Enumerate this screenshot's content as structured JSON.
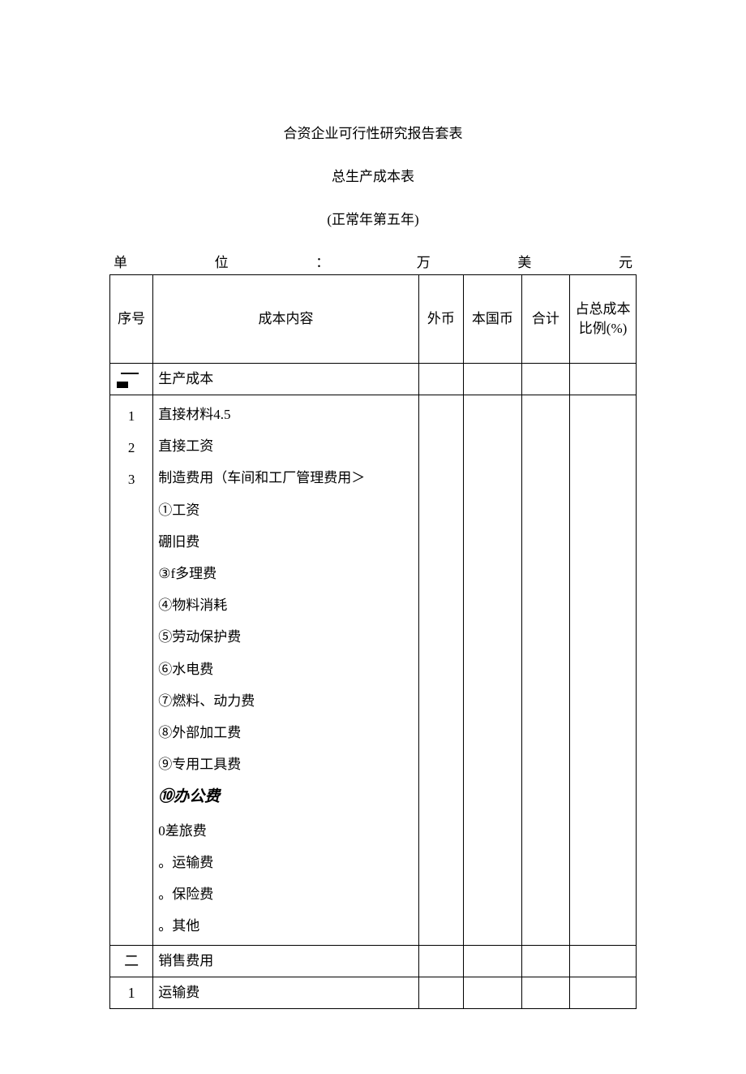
{
  "titles": {
    "main": "合资企业可行性研究报告套表",
    "sub": "总生产成本表",
    "note": "(正常年第五年)"
  },
  "unit_line": {
    "c1": "单",
    "c2": "位",
    "c3": "：",
    "c4": "万",
    "c5": "美",
    "c6": "元"
  },
  "headers": {
    "seq": "序号",
    "content": "成本内容",
    "fc": "外币",
    "local": "本国币",
    "total": "合计",
    "pct": "占总成本比例(%)"
  },
  "section1": {
    "seq_dash": "一",
    "seq_nums": [
      "1",
      "2",
      "3"
    ],
    "label": "生产成本",
    "items": [
      "直接材料4.5",
      "直接工资",
      "制造费用（车间和工厂管理费用＞",
      "①工资",
      "硼旧费",
      "③f多理费",
      "④物料消耗",
      "⑤劳动保护费",
      "⑥水电费",
      "⑦燃料、动力费",
      "⑧外部加工费",
      "⑨专用工具费",
      "⑩办公费",
      "0差旅费",
      "。运输费",
      "。保险费",
      "。其他"
    ]
  },
  "section2": {
    "seq": "二",
    "label": "销售费用"
  },
  "section3": {
    "seq": "1",
    "label": "运输费"
  }
}
